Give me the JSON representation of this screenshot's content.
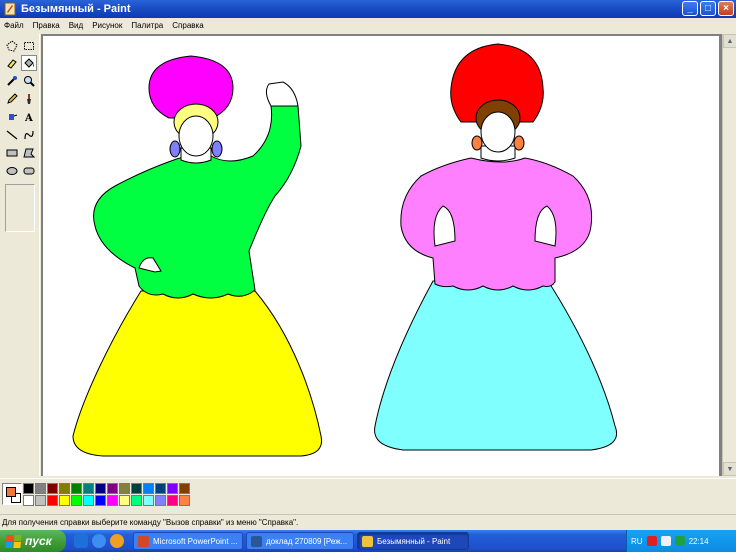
{
  "window": {
    "title": "Безымянный - Paint",
    "buttons": {
      "minimize": "_",
      "maximize": "□",
      "close": "×"
    }
  },
  "menu": [
    "Файл",
    "Правка",
    "Вид",
    "Рисунок",
    "Палитра",
    "Справка"
  ],
  "toolbox": {
    "tools": [
      "free-select-icon",
      "rect-select-icon",
      "eraser-icon",
      "fill-bucket-icon",
      "color-picker-icon",
      "magnifier-icon",
      "pencil-icon",
      "brush-icon",
      "airbrush-icon",
      "text-icon",
      "line-icon",
      "curve-icon",
      "rectangle-icon",
      "polygon-icon",
      "ellipse-icon",
      "rounded-rect-icon"
    ],
    "active_tool": "fill-bucket-icon"
  },
  "colors": {
    "foreground": "#f07838",
    "background": "#ffffff",
    "palette": [
      "#000000",
      "#808080",
      "#800000",
      "#808000",
      "#008000",
      "#008080",
      "#000080",
      "#800080",
      "#808040",
      "#004040",
      "#0080ff",
      "#004080",
      "#8000ff",
      "#804000",
      "#ffffff",
      "#c0c0c0",
      "#ff0000",
      "#ffff00",
      "#00ff00",
      "#00ffff",
      "#0000ff",
      "#ff00ff",
      "#ffff80",
      "#00ff80",
      "#80ffff",
      "#8080ff",
      "#ff0080",
      "#ff8040"
    ]
  },
  "drawing": {
    "left_figure": {
      "kokoshnik": "#ff00ff",
      "hair": "#ffff80",
      "earrings": "#8080ff",
      "blouse": "#00ff40",
      "skirt": "#ffff00"
    },
    "right_figure": {
      "kokoshnik": "#ff0000",
      "hair": "#804000",
      "earrings": "#ff8040",
      "blouse": "#ff80ff",
      "skirt": "#80ffff"
    }
  },
  "status": {
    "help_text": "Для получения справки выберите команду \"Вызов справки\" из меню \"Справка\"."
  },
  "taskbar": {
    "start_label": "пуск",
    "buttons": [
      {
        "label": "Microsoft PowerPoint ...",
        "color": "#d24726"
      },
      {
        "label": "доклад 270809 [Реж...",
        "color": "#2b5797"
      },
      {
        "label": "Безымянный - Paint",
        "color": "#f0c040"
      }
    ],
    "tray": {
      "lang": "RU",
      "time": "22:14"
    }
  }
}
